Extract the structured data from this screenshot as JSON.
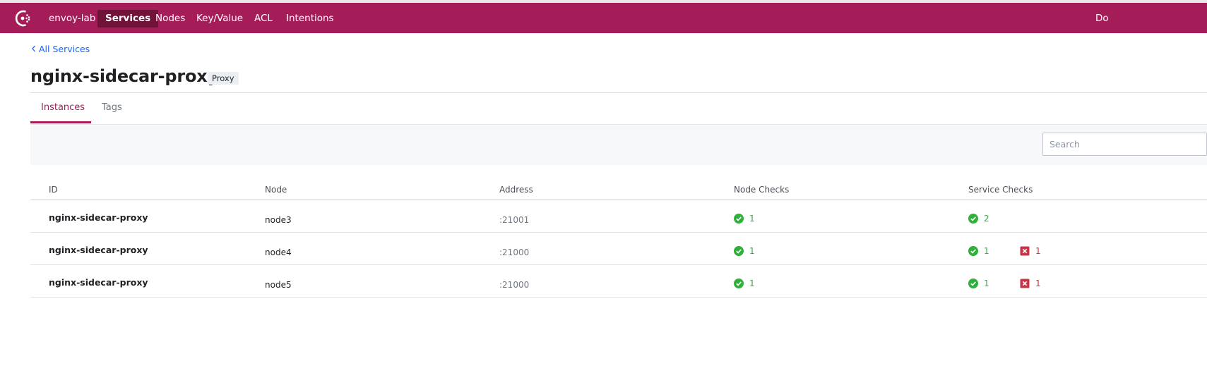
{
  "nav": {
    "datacenter": "envoy-lab",
    "items": [
      "Services",
      "Nodes",
      "Key/Value",
      "ACL",
      "Intentions"
    ],
    "active": "Services",
    "right_item": "Do"
  },
  "breadcrumb": {
    "label": "All Services"
  },
  "service": {
    "name": "nginx-sidecar-proxy",
    "badge": "Proxy"
  },
  "tabs": [
    {
      "label": "Instances",
      "selected": true
    },
    {
      "label": "Tags",
      "selected": false
    }
  ],
  "search": {
    "placeholder": "Search",
    "value": ""
  },
  "table": {
    "columns": [
      "ID",
      "Node",
      "Address",
      "Node Checks",
      "Service Checks"
    ],
    "rows": [
      {
        "id": "nginx-sidecar-proxy",
        "node": "node3",
        "address": ":21001",
        "node_checks_passing": "1",
        "service_checks_passing": "2",
        "service_checks_critical": ""
      },
      {
        "id": "nginx-sidecar-proxy",
        "node": "node4",
        "address": ":21000",
        "node_checks_passing": "1",
        "service_checks_passing": "1",
        "service_checks_critical": "1"
      },
      {
        "id": "nginx-sidecar-proxy",
        "node": "node5",
        "address": ":21000",
        "node_checks_passing": "1",
        "service_checks_passing": "1",
        "service_checks_critical": "1"
      }
    ]
  },
  "colors": {
    "brand": "#a51d58",
    "brand_dark": "#711339",
    "link": "#1563ff",
    "passing": "#2eb039",
    "critical": "#c73445"
  },
  "icons": {
    "logo": "consul-logo-icon",
    "breadcrumb": "chevron-left-icon",
    "passing": "check-circle-icon",
    "critical": "x-square-icon"
  }
}
